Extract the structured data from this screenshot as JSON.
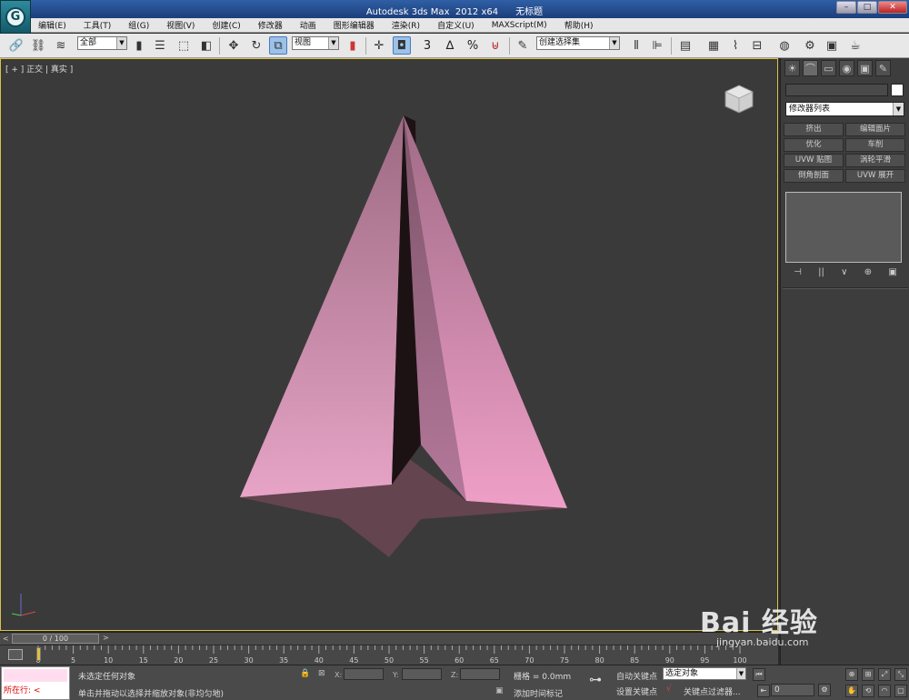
{
  "window": {
    "title": "Autodesk 3ds Max  2012 x64      无标题",
    "logo_letter": "G",
    "minimize": "–",
    "maximize": "□",
    "close": "✕"
  },
  "menu": [
    "编辑(E)",
    "工具(T)",
    "组(G)",
    "视图(V)",
    "创建(C)",
    "修改器",
    "动画",
    "图形编辑器",
    "渲染(R)",
    "自定义(U)",
    "MAXScript(M)",
    "帮助(H)"
  ],
  "toolbar": {
    "selection_filter": "全部",
    "ref_coord": "视图",
    "named_selection": "创建选择集",
    "snap_3": "3",
    "snap_angle": "∆",
    "snap_percent": "%"
  },
  "viewport": {
    "label": "[ + ] 正交 | 真实 ]",
    "object_color": "#d783ab",
    "background": "#3a3a3a",
    "border_color": "#d8c24a"
  },
  "command_panel": {
    "tabs": [
      "☀",
      "⌒",
      "▭",
      "◉",
      "▣",
      "✎"
    ],
    "modifier_list": "修改器列表",
    "modifier_buttons": [
      "挤出",
      "编辑面片",
      "优化",
      "车削",
      "UVW 贴图",
      "涡轮平滑",
      "倒角剖面",
      "UVW 展开"
    ],
    "stack_icons": [
      "⊣",
      "||",
      "∨",
      "⊕",
      "▣"
    ]
  },
  "timeline": {
    "left_arrow": "<",
    "frame_range": "0 / 100",
    "right_arrow": ">",
    "ticks": [
      "0",
      "5",
      "10",
      "15",
      "20",
      "25",
      "30",
      "35",
      "40",
      "45",
      "50",
      "55",
      "60",
      "65",
      "70",
      "75",
      "80",
      "85",
      "90",
      "95",
      "100"
    ]
  },
  "status": {
    "maxscript_label": "所在行:",
    "maxscript_arrow": "<",
    "selection_status": "未选定任何对象",
    "prompt": "单击并拖动以选择并缩放对象(非均匀地)",
    "x_label": "X:",
    "y_label": "Y:",
    "z_label": "Z:",
    "grid": "栅格 = 0.0mm",
    "add_time_tag": "添加时间标记",
    "auto_key": "自动关键点",
    "selected_object": "选定对象",
    "set_key": "设置关键点",
    "key_filters": "关键点过滤器...",
    "current_frame": "0"
  },
  "watermark": {
    "text": "Bai 经验",
    "url": "jingyan.baidu.com"
  }
}
